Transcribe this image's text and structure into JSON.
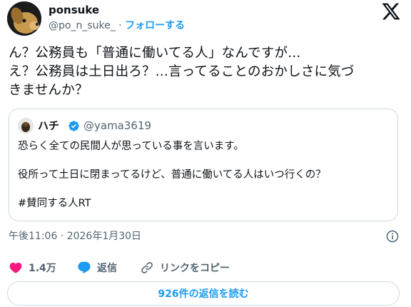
{
  "author": {
    "display_name": "ponsuke",
    "handle": "@po_n_suke_",
    "separator": "·",
    "follow_label": "フォローする"
  },
  "tweet": {
    "lines": [
      "ん？公務員も「普通に働いてる人」なんですが...",
      "え？公務員は土日出ろ？...言ってることのおかしさに気づ",
      "きませんか？"
    ]
  },
  "quote": {
    "display_name": "ハチ",
    "handle": "@yama3619",
    "lines": [
      "恐らく全ての民間人が思っている事を言います。",
      "役所って土日に閉まってるけど、普通に働いてる人はいつ行くの？",
      "#賛同する人RT"
    ]
  },
  "timestamp": "午後11:06 · 2026年1月30日",
  "actions": {
    "like_count": "1.4万",
    "reply_label": "返信",
    "copy_link_label": "リンクをコピー"
  },
  "read_replies_label": "926件の返信を読む",
  "colors": {
    "accent": "#1d9bf0",
    "like": "#f91880",
    "secondary_text": "#536471",
    "border": "#cfd9de"
  },
  "icons": [
    "x-logo-icon",
    "verified-badge-icon",
    "info-icon",
    "heart-icon",
    "reply-bubble-icon",
    "link-icon"
  ]
}
